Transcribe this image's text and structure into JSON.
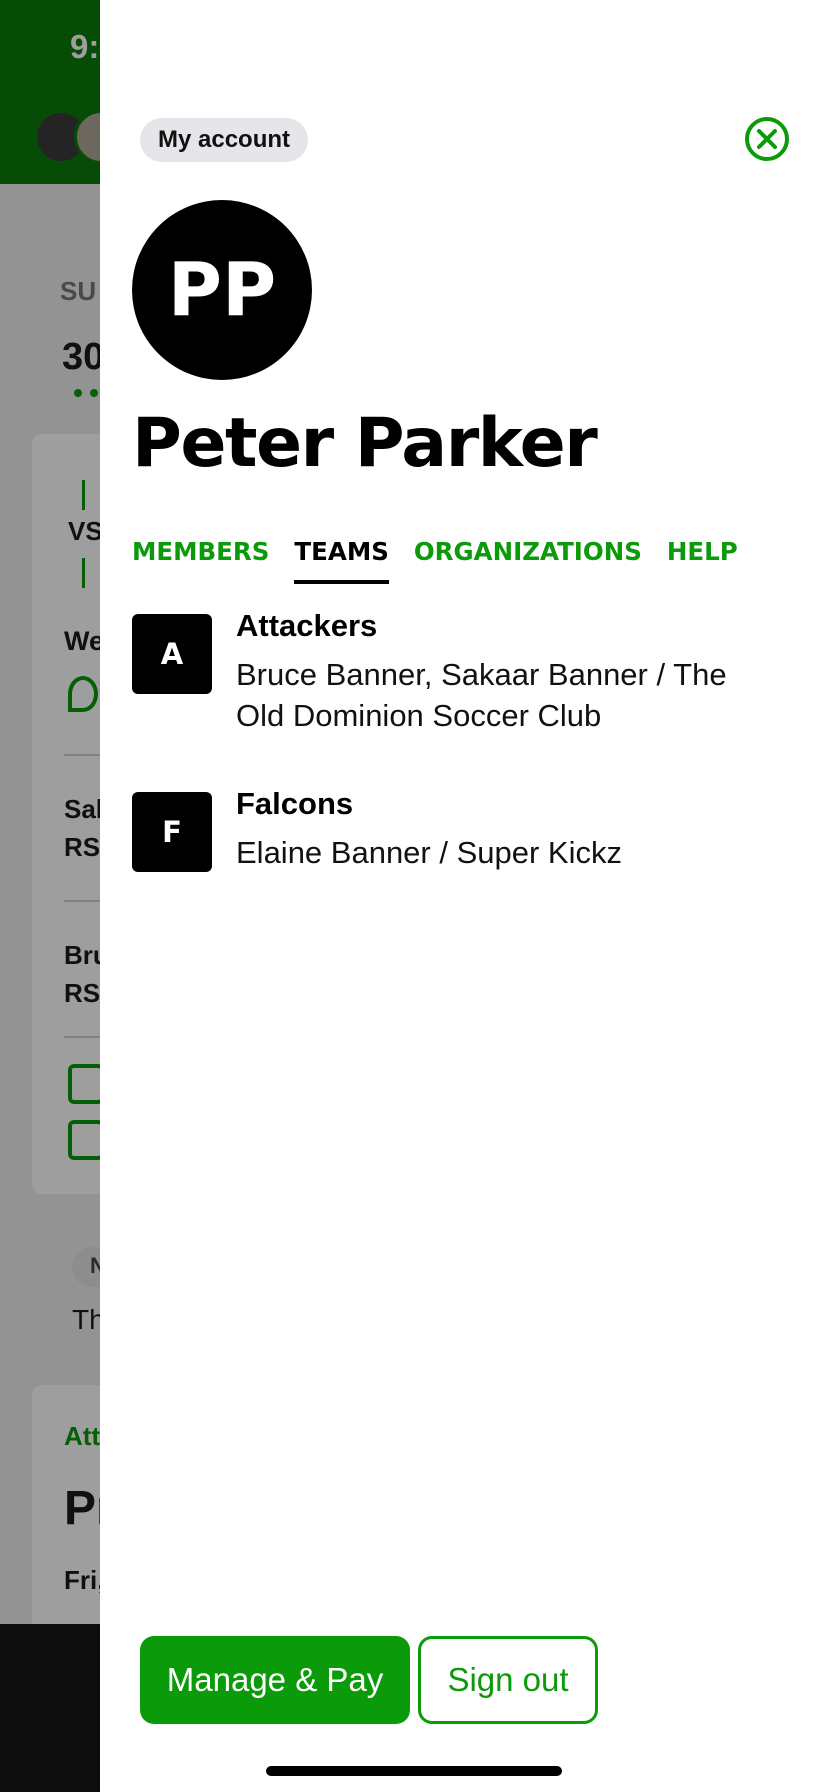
{
  "status_bar": {
    "time": "9:"
  },
  "background": {
    "day_label": "SU",
    "date_label": "30",
    "vs_label": "VS",
    "row1_label": "We",
    "row2_line1": "Sal",
    "row2_line2": "RS",
    "row3_line1": "Bru",
    "row3_line2": "RS",
    "pill_label": "N",
    "section_text": "Th",
    "card2_team": "Att",
    "card2_title": "Pr",
    "card2_date": "Fri,"
  },
  "drawer": {
    "account_label": "My account",
    "close_icon": "close-circle-icon",
    "avatar_initials": "PP",
    "user_name": "Peter Parker",
    "tabs": [
      {
        "label": "MEMBERS",
        "active": false
      },
      {
        "label": "TEAMS",
        "active": true
      },
      {
        "label": "ORGANIZATIONS",
        "active": false
      },
      {
        "label": "HELP",
        "active": false
      }
    ],
    "teams": [
      {
        "initial": "A",
        "name": "Attackers",
        "subtitle": "Bruce Banner, Sakaar Banner / The Old Dominion Soccer Club"
      },
      {
        "initial": "F",
        "name": "Falcons",
        "subtitle": "Elaine Banner / Super Kickz"
      }
    ],
    "manage_pay_label": "Manage & Pay",
    "sign_out_label": "Sign out"
  },
  "colors": {
    "brand_green": "#0a9a0a",
    "header_green": "#0a7a0a",
    "text": "#000000"
  }
}
